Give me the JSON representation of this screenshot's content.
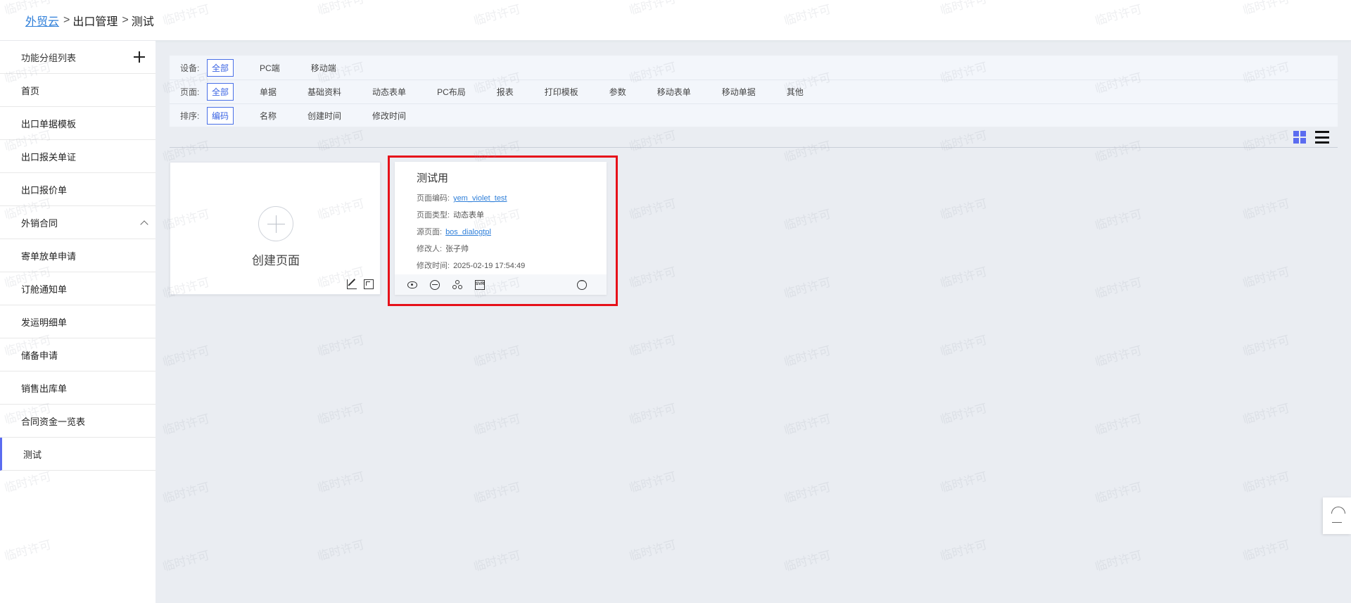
{
  "breadcrumb": {
    "root": "外贸云",
    "level1": "出口管理",
    "current": "测试"
  },
  "sidebar": {
    "header": "功能分组列表",
    "items": [
      {
        "label": "首页"
      },
      {
        "label": "出口单据模板"
      },
      {
        "label": "出口报关单证"
      },
      {
        "label": "出口报价单"
      },
      {
        "label": "外销合同",
        "expanded": true
      },
      {
        "label": "寄单放单申请"
      },
      {
        "label": "订舱通知单"
      },
      {
        "label": "发运明细单"
      },
      {
        "label": "储备申请"
      },
      {
        "label": "销售出库单"
      },
      {
        "label": "合同资金一览表"
      },
      {
        "label": "测试",
        "active": true
      }
    ]
  },
  "filters": {
    "device": {
      "label": "设备:",
      "options": [
        "全部",
        "PC端",
        "移动端"
      ],
      "selected": "全部"
    },
    "page": {
      "label": "页面:",
      "options": [
        "全部",
        "单据",
        "基础资料",
        "动态表单",
        "PC布局",
        "报表",
        "打印模板",
        "参数",
        "移动表单",
        "移动单据",
        "其他"
      ],
      "selected": "全部"
    },
    "sort": {
      "label": "排序:",
      "options": [
        "编码",
        "名称",
        "创建时间",
        "修改时间"
      ],
      "selected": "编码"
    }
  },
  "create_card": {
    "label": "创建页面"
  },
  "page_card": {
    "title": "测试用",
    "code_label": "页面编码:",
    "code_value": "yem_violet_test",
    "type_label": "页面类型:",
    "type_value": "动态表单",
    "source_label": "源页面:",
    "source_value": "bos_dialogtpl",
    "modifier_label": "修改人:",
    "modifier_value": "张子帅",
    "modified_label": "修改时间:",
    "modified_value": "2025-02-19 17:54:49"
  },
  "watermark": "临时许可",
  "colors": {
    "accent": "#5b6cf0",
    "link": "#2f7fd9",
    "highlight": "#e6111a",
    "background": "#eaedf2"
  }
}
